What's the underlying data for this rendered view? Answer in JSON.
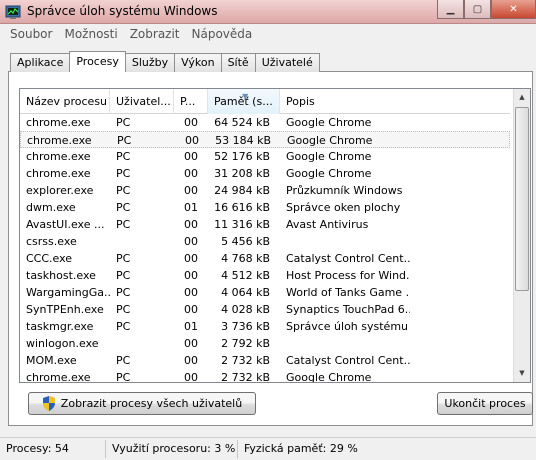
{
  "window": {
    "title": "Správce úloh systému Windows",
    "controls": [
      "minimize-icon",
      "maximize-icon",
      "close-icon"
    ]
  },
  "menu": [
    "Soubor",
    "Možnosti",
    "Zobrazit",
    "Nápověda"
  ],
  "tabs": [
    {
      "label": "Aplikace",
      "active": false
    },
    {
      "label": "Procesy",
      "active": true
    },
    {
      "label": "Služby",
      "active": false
    },
    {
      "label": "Výkon",
      "active": false
    },
    {
      "label": "Sítě",
      "active": false
    },
    {
      "label": "Uživatelé",
      "active": false
    }
  ],
  "table": {
    "headers": [
      "Název procesu",
      "Uživatel...",
      "P...",
      "Paměť (s...",
      "Popis"
    ],
    "sorted_column": "Paměť (s...",
    "rows": [
      [
        "chrome.exe",
        "PC",
        "00",
        "64 524 kB",
        "Google Chrome"
      ],
      [
        "chrome.exe",
        "PC",
        "00",
        "53 184 kB",
        "Google Chrome"
      ],
      [
        "chrome.exe",
        "PC",
        "00",
        "52 176 kB",
        "Google Chrome"
      ],
      [
        "chrome.exe",
        "PC",
        "00",
        "31 208 kB",
        "Google Chrome"
      ],
      [
        "explorer.exe",
        "PC",
        "00",
        "24 984 kB",
        "Průzkumník Windows"
      ],
      [
        "dwm.exe",
        "PC",
        "01",
        "16 616 kB",
        "Správce oken plochy"
      ],
      [
        "AvastUI.exe ...",
        "PC",
        "00",
        "11 316 kB",
        "Avast Antivirus"
      ],
      [
        "csrss.exe",
        "",
        "00",
        "5 456 kB",
        ""
      ],
      [
        "CCC.exe",
        "PC",
        "00",
        "4 768 kB",
        "Catalyst Control Cent..."
      ],
      [
        "taskhost.exe",
        "PC",
        "00",
        "4 512 kB",
        "Host Process for Wind..."
      ],
      [
        "WargamingGa...",
        "PC",
        "00",
        "4 064 kB",
        "World of Tanks Game ..."
      ],
      [
        "SynTPEnh.exe",
        "PC",
        "00",
        "4 028 kB",
        "Synaptics TouchPad 6..."
      ],
      [
        "taskmgr.exe",
        "PC",
        "01",
        "3 736 kB",
        "Správce úloh systému ..."
      ],
      [
        "winlogon.exe",
        "",
        "00",
        "2 792 kB",
        ""
      ],
      [
        "MOM.exe",
        "PC",
        "00",
        "2 732 kB",
        "Catalyst Control Cent..."
      ],
      [
        "chrome.exe",
        "PC",
        "00",
        "2 732 kB",
        "Google Chrome"
      ]
    ],
    "selected_row": 1
  },
  "buttons": {
    "show_all": "Zobrazit procesy všech uživatelů",
    "end_process": "Ukončit proces"
  },
  "status": {
    "processes": "Procesy: 54",
    "cpu": "Využití procesoru: 3 %",
    "memory": "Fyzická paměť: 29 %"
  },
  "colors": {
    "titlebar": "#e6b8b8",
    "background": "#f0f0f0"
  }
}
